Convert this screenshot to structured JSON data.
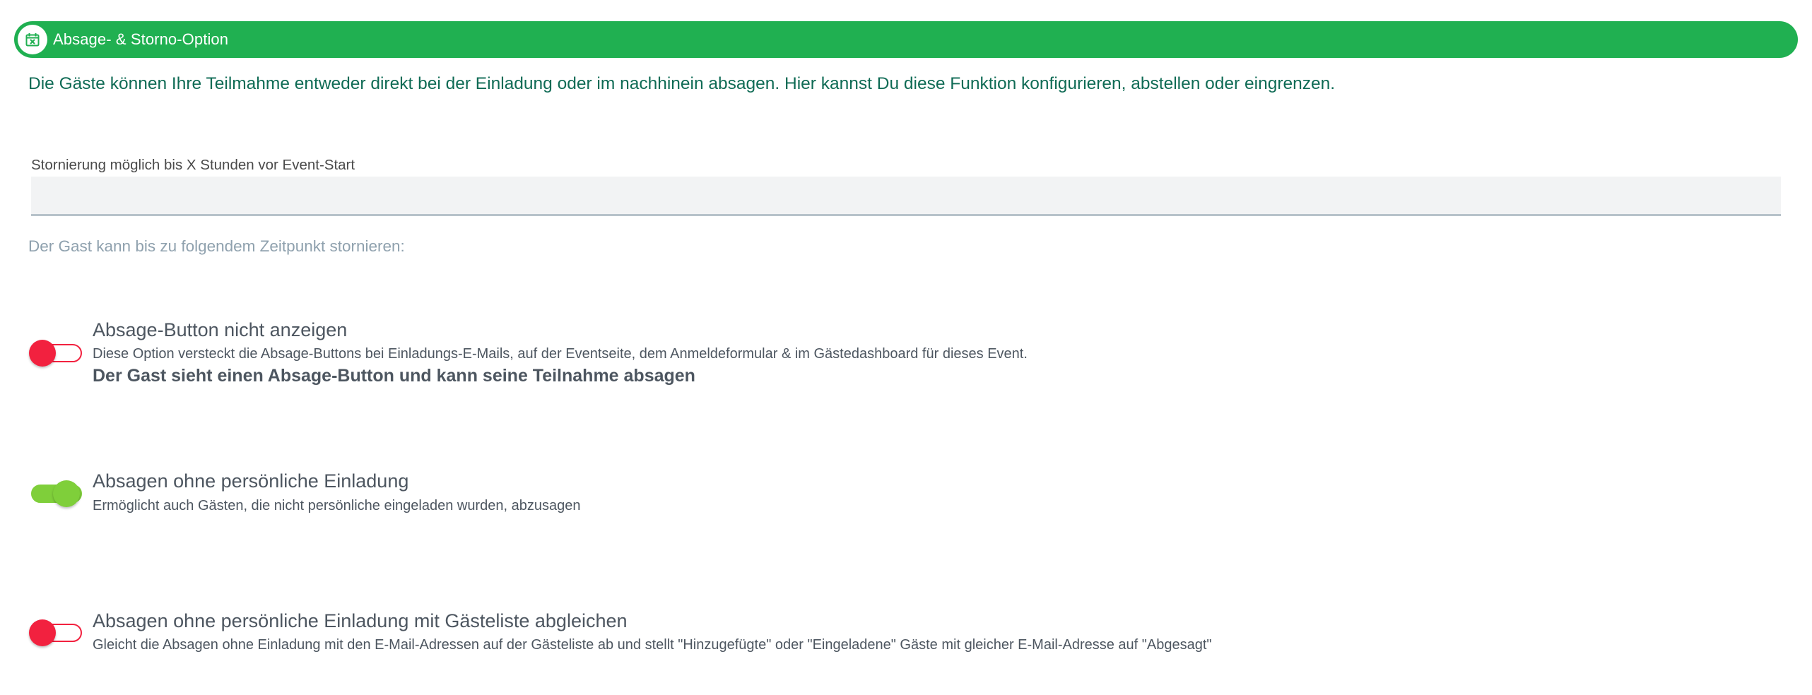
{
  "header": {
    "icon": "calendar-cancel-icon",
    "title": "Absage- & Storno-Option",
    "color": "#20b051"
  },
  "intro": "Die Gäste können Ihre Teilmahme entweder direkt bei der Einladung oder im nachhinein absagen. Hier kannst Du diese Funktion konfigurieren, abstellen oder eingrenzen.",
  "cancellation_field": {
    "label": "Stornierung möglich bis X Stunden vor Event-Start",
    "value": "",
    "hint": "Der Gast kann bis zu folgendem Zeitpunkt stornieren:"
  },
  "options": [
    {
      "title": "Absage-Button nicht anzeigen",
      "description": "Diese Option versteckt die Absage-Buttons bei Einladungs-E-Mails, auf der Eventseite, dem Anmeldeformular & im Gästedashboard für dieses Event.",
      "status": "Der Gast sieht einen Absage-Button und kann seine Teilnahme absagen",
      "enabled": false
    },
    {
      "title": "Absagen ohne persönliche Einladung",
      "description": "Ermöglicht auch Gästen, die nicht persönliche eingeladen wurden, abzusagen",
      "enabled": true
    },
    {
      "title": "Absagen ohne persönliche Einladung mit Gästeliste abgleichen",
      "description": "Gleicht die Absagen ohne Einladung mit den E-Mail-Adressen auf der Gästeliste ab und stellt \"Hinzugefügte\" oder \"Eingeladene\" Gäste mit gleicher E-Mail-Adresse auf \"Abgesagt\"",
      "enabled": false
    }
  ],
  "colors": {
    "toggle_on": "#7fcf3a",
    "toggle_off": "#f2213f",
    "intro_text": "#0f6b55"
  }
}
